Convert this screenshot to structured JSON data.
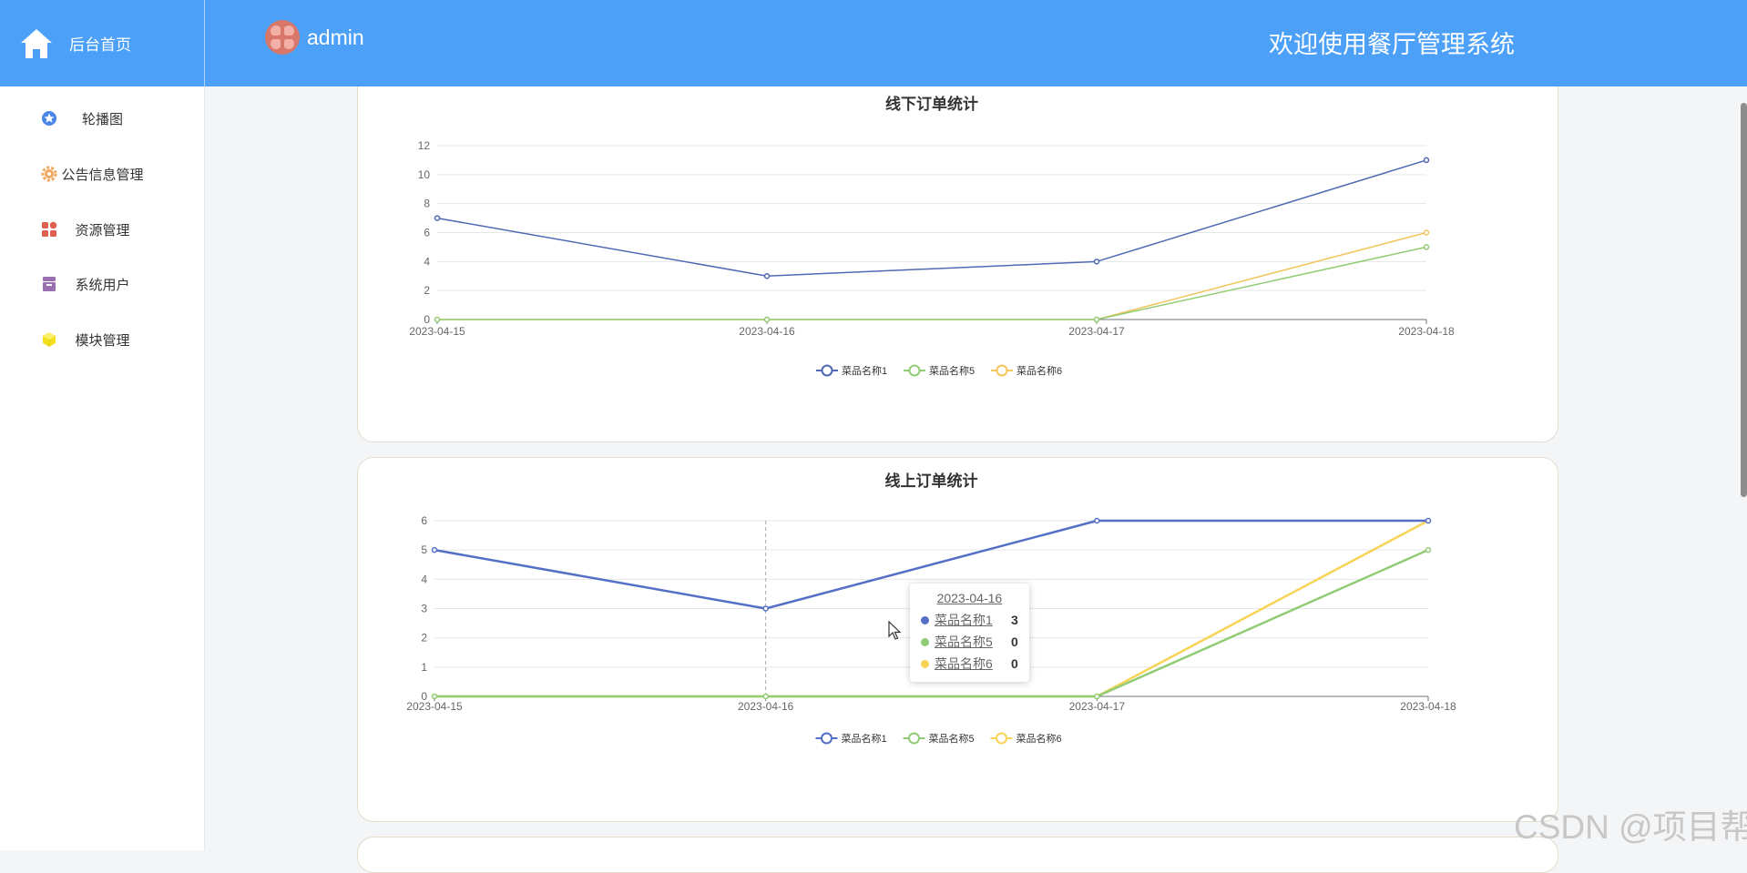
{
  "header": {
    "brand_label": "后台首页",
    "user_name": "admin",
    "welcome": "欢迎使用餐厅管理系统",
    "colors": {
      "bar": "#4ca0f7"
    }
  },
  "sidebar": {
    "items": [
      {
        "label": "轮播图",
        "icon": "star-badge-icon",
        "color": "#4a86e8"
      },
      {
        "label": "公告信息管理",
        "icon": "gear-icon",
        "color": "#f0a860"
      },
      {
        "label": "资源管理",
        "icon": "grid-icon",
        "color": "#e06050"
      },
      {
        "label": "系统用户",
        "icon": "archive-icon",
        "color": "#9a6fb0"
      },
      {
        "label": "模块管理",
        "icon": "cube-icon",
        "color": "#f5e020"
      }
    ]
  },
  "chart_data": [
    {
      "type": "line",
      "title": "线下订单统计",
      "categories": [
        "2023-04-15",
        "2023-04-16",
        "2023-04-17",
        "2023-04-18"
      ],
      "series": [
        {
          "name": "菜品名称1",
          "values": [
            7,
            3,
            4,
            11
          ],
          "color": "#4f6ab3"
        },
        {
          "name": "菜品名称5",
          "values": [
            0,
            0,
            0,
            5
          ],
          "color": "#91cc75"
        },
        {
          "name": "菜品名称6",
          "values": [
            0,
            0,
            0,
            6
          ],
          "color": "#f2c65d"
        }
      ],
      "ylim": [
        0,
        12
      ],
      "yticks": [
        0,
        2,
        4,
        6,
        8,
        10,
        12
      ],
      "grid": true,
      "legend": "bottom-center"
    },
    {
      "type": "line",
      "title": "线上订单统计",
      "categories": [
        "2023-04-15",
        "2023-04-16",
        "2023-04-17",
        "2023-04-18"
      ],
      "series": [
        {
          "name": "菜品名称1",
          "values": [
            5,
            3,
            6,
            6
          ],
          "color": "#5470c6"
        },
        {
          "name": "菜品名称5",
          "values": [
            0,
            0,
            0,
            5
          ],
          "color": "#91cc75"
        },
        {
          "name": "菜品名称6",
          "values": [
            0,
            0,
            0,
            6
          ],
          "color": "#f7d356"
        }
      ],
      "ylim": [
        0,
        6
      ],
      "yticks": [
        0,
        1,
        2,
        3,
        4,
        5,
        6
      ],
      "grid": true,
      "legend": "bottom-center",
      "tooltip": {
        "title": "2023-04-16",
        "rows": [
          {
            "name": "菜品名称1",
            "value": "3",
            "color": "#5470c6"
          },
          {
            "name": "菜品名称5",
            "value": "0",
            "color": "#91cc75"
          },
          {
            "name": "菜品名称6",
            "value": "0",
            "color": "#f7d356"
          }
        ]
      }
    }
  ],
  "watermark": "CSDN @项目帮"
}
